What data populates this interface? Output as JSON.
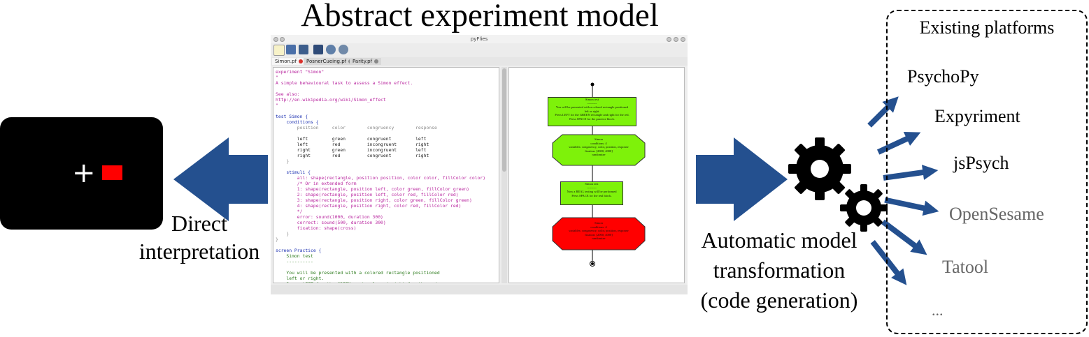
{
  "title": "Abstract experiment model",
  "left_label": [
    "Direct",
    "interpretation"
  ],
  "middle_label": [
    "Automatic model",
    "transformation",
    "(code generation)"
  ],
  "platforms_box": {
    "title": "Existing platforms",
    "items": [
      {
        "name": "PsychoPy",
        "color": "#000000"
      },
      {
        "name": "Expyriment",
        "color": "#000000"
      },
      {
        "name": "jsPsych",
        "color": "#000000"
      },
      {
        "name": "OpenSesame",
        "color": "#666666"
      },
      {
        "name": "Tatool",
        "color": "#666666"
      },
      {
        "name": "...",
        "color": "#666666"
      }
    ]
  },
  "stimulus": {
    "fixation": "+",
    "rect_color": "#ff0000"
  },
  "arrow_color": "#24508f",
  "icons": [
    "gear-icon-large",
    "gear-icon-small",
    "new-file-icon",
    "open-folder-icon",
    "save-icon",
    "image-icon",
    "zoom-icon",
    "settings-icon"
  ],
  "window": {
    "title": "pyFlies",
    "tabs": [
      {
        "label": "Simon.pf",
        "active": true
      },
      {
        "label": "PosnerCueing.pf",
        "active": false
      },
      {
        "label": "Parity.pf",
        "active": false
      }
    ],
    "code_lines": [
      {
        "text": "experiment \"Simon\"",
        "cls": "c-mag"
      },
      {
        "text": "\"",
        "cls": "c-mag"
      },
      {
        "text": "A simple behavioural task to assess a Simon effect.",
        "cls": "c-mag"
      },
      {
        "text": "",
        "cls": "c-dk"
      },
      {
        "text": "See also:",
        "cls": "c-mag"
      },
      {
        "text": "http://en.wikipedia.org/wiki/Simon_effect",
        "cls": "c-mag"
      },
      {
        "text": "\"",
        "cls": "c-mag"
      },
      {
        "text": "",
        "cls": "c-dk"
      },
      {
        "text": "test Simon {",
        "cls": "c-blue"
      },
      {
        "text": "    conditions {",
        "cls": "c-blue"
      },
      {
        "text": "        position     color        congruency        response",
        "cls": "c-gray"
      },
      {
        "text": "",
        "cls": "c-dk"
      },
      {
        "text": "        left         green        congruent         left",
        "cls": "c-dk"
      },
      {
        "text": "        left         red          incongruent       right",
        "cls": "c-dk"
      },
      {
        "text": "        right        green        incongruent       left",
        "cls": "c-dk"
      },
      {
        "text": "        right        red          congruent         right",
        "cls": "c-dk"
      },
      {
        "text": "    }",
        "cls": "c-gray"
      },
      {
        "text": "",
        "cls": "c-dk"
      },
      {
        "text": "    stimuli {",
        "cls": "c-blue"
      },
      {
        "text": "        all: shape(rectangle, position position, color color, fillColor color)",
        "cls": "c-mag"
      },
      {
        "text": "        /* Or in extended form",
        "cls": "c-mag"
      },
      {
        "text": "        1: shape(rectangle, position left, color green, fillColor green)",
        "cls": "c-mag"
      },
      {
        "text": "        2: shape(rectangle, position left, color red, fillColor red)",
        "cls": "c-mag"
      },
      {
        "text": "        3: shape(rectangle, position right, color green, fillColor green)",
        "cls": "c-mag"
      },
      {
        "text": "        4: shape(rectangle, position right, color red, fillColor red)",
        "cls": "c-mag"
      },
      {
        "text": "        */",
        "cls": "c-mag"
      },
      {
        "text": "        error: sound(1000, duration 300)",
        "cls": "c-mag"
      },
      {
        "text": "        correct: sound(500, duration 300)",
        "cls": "c-mag"
      },
      {
        "text": "        fixation: shape(cross)",
        "cls": "c-mag"
      },
      {
        "text": "    }",
        "cls": "c-gray"
      },
      {
        "text": "}",
        "cls": "c-gray"
      },
      {
        "text": "",
        "cls": "c-dk"
      },
      {
        "text": "screen Practice {",
        "cls": "c-blue"
      },
      {
        "text": "    Simon test",
        "cls": "c-grn"
      },
      {
        "text": "    ----------",
        "cls": "c-grn"
      },
      {
        "text": "",
        "cls": "c-dk"
      },
      {
        "text": "    You will be presented with a colored rectangle positioned",
        "cls": "c-grn"
      },
      {
        "text": "    left or right.",
        "cls": "c-grn"
      },
      {
        "text": "    Press LEFT for the GREEN rectangle and right for the red.",
        "cls": "c-grn"
      }
    ],
    "flow": {
      "practice_box": [
        "Simon test",
        "---------",
        "You will be presented with a colored rectangle positioned",
        "left or right.",
        "Press LEFT for the GREEN rectangle and right for the red.",
        "Press SPACE for the practice block."
      ],
      "practice_test": [
        "Simon",
        "conditions: 4",
        "variables: congruency, color, position, response",
        "fixation: [2000, 4000]",
        "randomize"
      ],
      "real_box": [
        "Simon test",
        "---------",
        "Now a REAL testing will be performed",
        "Press SPACE for the real block."
      ],
      "real_test": [
        "Simon",
        "conditions: 4",
        "variables: congruency, color, position, response",
        "fixation: [2000, 4000]",
        "randomize"
      ]
    }
  }
}
